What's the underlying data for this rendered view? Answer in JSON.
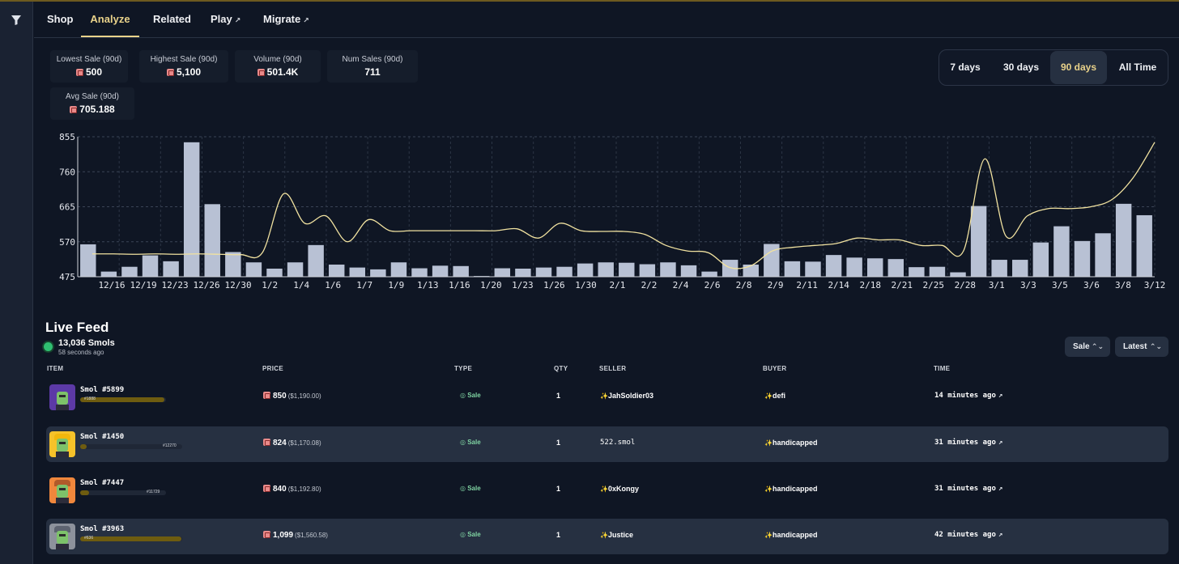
{
  "nav": {
    "tabs": [
      {
        "label": "Shop",
        "external": false
      },
      {
        "label": "Analyze",
        "external": false,
        "active": true
      },
      {
        "label": "Related",
        "external": false
      },
      {
        "label": "Play",
        "external": true
      },
      {
        "label": "Migrate",
        "external": true
      }
    ],
    "external_icon": "↗"
  },
  "stats": {
    "lowest": {
      "label": "Lowest Sale (90d)",
      "value": "500"
    },
    "highest": {
      "label": "Highest Sale (90d)",
      "value": "5,100"
    },
    "volume": {
      "label": "Volume (90d)",
      "value": "501.4K"
    },
    "num_sales": {
      "label": "Num Sales (90d)",
      "value": "711"
    },
    "avg": {
      "label": "Avg Sale (90d)",
      "value": "705.188"
    }
  },
  "range": {
    "options": [
      "7 days",
      "30 days",
      "90 days",
      "All Time"
    ],
    "selected": "90 days"
  },
  "colors": {
    "accent": "#e9d28a",
    "bar": "#b8c1d4",
    "line": "#f1e2a0",
    "live": "#2fbf71",
    "sale": "#7fd3a2"
  },
  "chart_data": {
    "type": "bar",
    "ylim": [
      475,
      855
    ],
    "yticks": [
      "475",
      "570",
      "665",
      "760",
      "855"
    ],
    "grid": true,
    "x_tick_labels": [
      "12/16",
      "12/19",
      "12/23",
      "12/26",
      "12/30",
      "1/2",
      "1/4",
      "1/6",
      "1/7",
      "1/9",
      "1/13",
      "1/16",
      "1/20",
      "1/23",
      "1/26",
      "1/30",
      "2/1",
      "2/2",
      "2/4",
      "2/6",
      "2/8",
      "2/9",
      "2/11",
      "2/14",
      "2/18",
      "2/21",
      "2/25",
      "2/28",
      "3/1",
      "3/3",
      "3/5",
      "3/6",
      "3/8",
      "3/12"
    ],
    "values": [
      563,
      489,
      502,
      533,
      517,
      840,
      672,
      542,
      514,
      497,
      514,
      561,
      508,
      500,
      495,
      514,
      498,
      505,
      504,
      477,
      498,
      497,
      500,
      502,
      511,
      514,
      513,
      509,
      514,
      506,
      489,
      521,
      508,
      564,
      517,
      516,
      534,
      527,
      525,
      523,
      501,
      502,
      487,
      667,
      521,
      521,
      568,
      612,
      572,
      593,
      673,
      642
    ],
    "trend": [
      537,
      537,
      536,
      537,
      536,
      537,
      536,
      535,
      540,
      700,
      620,
      640,
      570,
      630,
      600,
      600,
      600,
      600,
      600,
      600,
      605,
      580,
      620,
      600,
      598,
      598,
      590,
      560,
      545,
      540,
      500,
      505,
      545,
      555,
      560,
      565,
      580,
      575,
      575,
      560,
      560,
      545,
      795,
      585,
      640,
      660,
      660,
      665,
      685,
      745,
      840
    ]
  },
  "feed": {
    "title": "Live Feed",
    "count": "13,036 Smols",
    "updated": "58 seconds ago",
    "filter": "Sale",
    "sort": "Latest",
    "columns": {
      "item": "ITEM",
      "price": "PRICE",
      "type": "TYPE",
      "qty": "QTY",
      "seller": "SELLER",
      "buyer": "BUYER",
      "time": "TIME"
    },
    "rows": [
      {
        "name": "Smol #5899",
        "rank": "#1888",
        "rank_fill": 0.98,
        "price": "850",
        "usd": "($1,190.00)",
        "type": "Sale",
        "qty": "1",
        "seller": "JahSoldier03",
        "seller_verified": true,
        "buyer": "defi",
        "time": "14 minutes ago",
        "hat": "#5b3aa8",
        "bg": "#5c39a6"
      },
      {
        "name": "Smol #1450",
        "rank": "#12270",
        "rank_fill": 0.06,
        "price": "824",
        "usd": "($1,170.08)",
        "type": "Sale",
        "qty": "1",
        "seller": "522.smol",
        "seller_verified": false,
        "buyer": "handicapped",
        "time": "31 minutes ago",
        "hat": "#f2b70c",
        "bg": "#f6c22a"
      },
      {
        "name": "Smol #7447",
        "rank": "#11729",
        "rank_fill": 0.1,
        "price": "840",
        "usd": "($1,192.80)",
        "type": "Sale",
        "qty": "1",
        "seller": "0xKongy",
        "seller_verified": true,
        "buyer": "handicapped",
        "time": "31 minutes ago",
        "hat": "#b05a2a",
        "bg": "#f0873c"
      },
      {
        "name": "Smol #3963",
        "rank": "#636",
        "rank_fill": 0.99,
        "price": "1,099",
        "usd": "($1,560.58)",
        "type": "Sale",
        "qty": "1",
        "seller": "Justice",
        "seller_verified": true,
        "buyer": "handicapped",
        "time": "42 minutes ago",
        "hat": "#5d6370",
        "bg": "#8d929c"
      }
    ]
  }
}
